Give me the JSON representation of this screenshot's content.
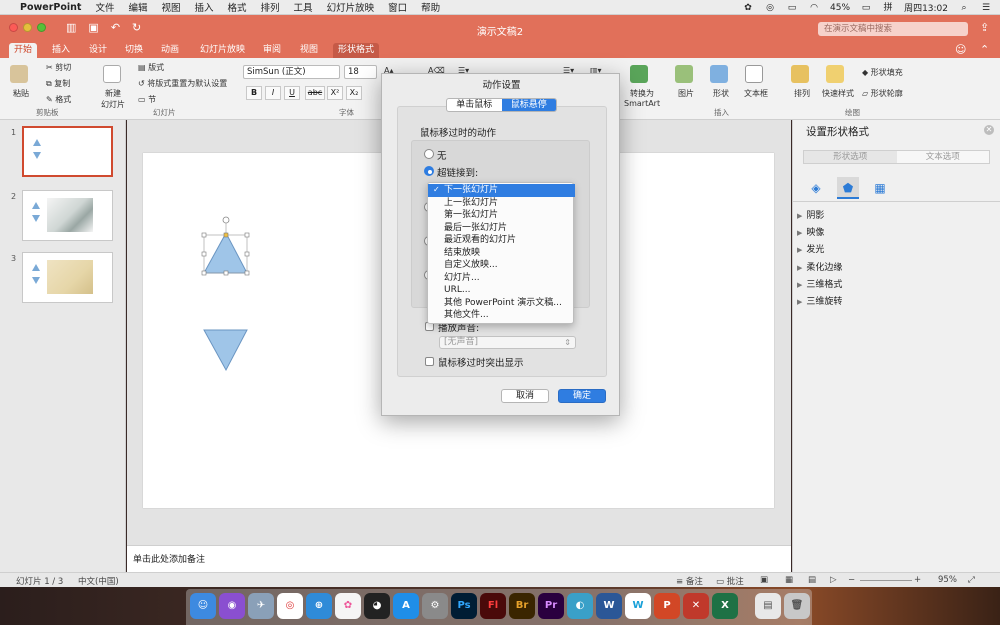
{
  "menubar": {
    "app_name": "PowerPoint",
    "items": [
      "文件",
      "编辑",
      "视图",
      "插入",
      "格式",
      "排列",
      "工具",
      "幻灯片放映",
      "窗口",
      "帮助"
    ],
    "battery": "45%",
    "clock": "周四13:02"
  },
  "window": {
    "title": "演示文稿2",
    "search_placeholder": "在演示文稿中搜索"
  },
  "tabs": [
    "开始",
    "插入",
    "设计",
    "切换",
    "动画",
    "幻灯片放映",
    "审阅",
    "视图",
    "形状格式"
  ],
  "ribbon": {
    "paste": "粘贴",
    "cut": "剪切",
    "copy": "复制",
    "format": "格式",
    "clipboard_group": "剪贴板",
    "new_slide": "新建\n幻灯片",
    "layout": "版式",
    "reset": "将版式重置为默认设置",
    "section": "节",
    "slides_group": "幻灯片",
    "font_name": "SimSun (正文)",
    "font_size": "18",
    "font_group": "字体",
    "bold": "B",
    "italic": "I",
    "underline": "U",
    "strike": "abc",
    "superscript": "X²",
    "subscript": "X₂",
    "convert_smartart": "转换为\nSmartArt",
    "picture": "图片",
    "shape": "形状",
    "textbox": "文本框",
    "insert_group": "插入",
    "arrange": "排列",
    "quick_styles": "快速样式",
    "shape_fill": "形状填充",
    "shape_outline": "形状轮廓",
    "drawing_group": "绘图"
  },
  "slides": [
    {
      "num": "1"
    },
    {
      "num": "2"
    },
    {
      "num": "3"
    }
  ],
  "notes_placeholder": "单击此处添加备注",
  "format_pane": {
    "title": "设置形状格式",
    "tab_shape": "形状选项",
    "tab_text": "文本选项",
    "properties": [
      "阴影",
      "映像",
      "发光",
      "柔化边缘",
      "三维格式",
      "三维旋转"
    ]
  },
  "statusbar": {
    "slide_info": "幻灯片 1 / 3",
    "language": "中文(中国)",
    "notes": "备注",
    "comments": "批注",
    "zoom": "95%"
  },
  "dialog": {
    "title": "动作设置",
    "tab_click": "单击鼠标",
    "tab_hover": "鼠标悬停",
    "heading": "鼠标移过时的动作",
    "opt_none": "无",
    "opt_hyperlink": "超链接到:",
    "play_sound": "播放声音:",
    "sound_value": "[无声音]",
    "highlight": "鼠标移过时突出显示",
    "cancel": "取消",
    "ok": "确定"
  },
  "dropdown": {
    "items": [
      "下一张幻灯片",
      "上一张幻灯片",
      "第一张幻灯片",
      "最后一张幻灯片",
      "最近观看的幻灯片",
      "结束放映",
      "自定义放映...",
      "幻灯片...",
      "URL...",
      "其他 PowerPoint 演示文稿...",
      "其他文件..."
    ],
    "selected_index": 0
  },
  "dock_apps": [
    "Finder",
    "Siri",
    "Launchpad",
    "Chrome",
    "Safari",
    "Photos",
    "QQ",
    "App Store",
    "System Preferences",
    "Ps",
    "Fl",
    "Br",
    "Pr",
    "Browser",
    "Word",
    "WPS",
    "PowerPoint",
    "Excel Sheet",
    "Excel",
    "Preview",
    "Trash"
  ],
  "colors": {
    "accent": "#e1705a",
    "selection": "#2f7de1",
    "shape_fill": "#9fc5e8"
  }
}
